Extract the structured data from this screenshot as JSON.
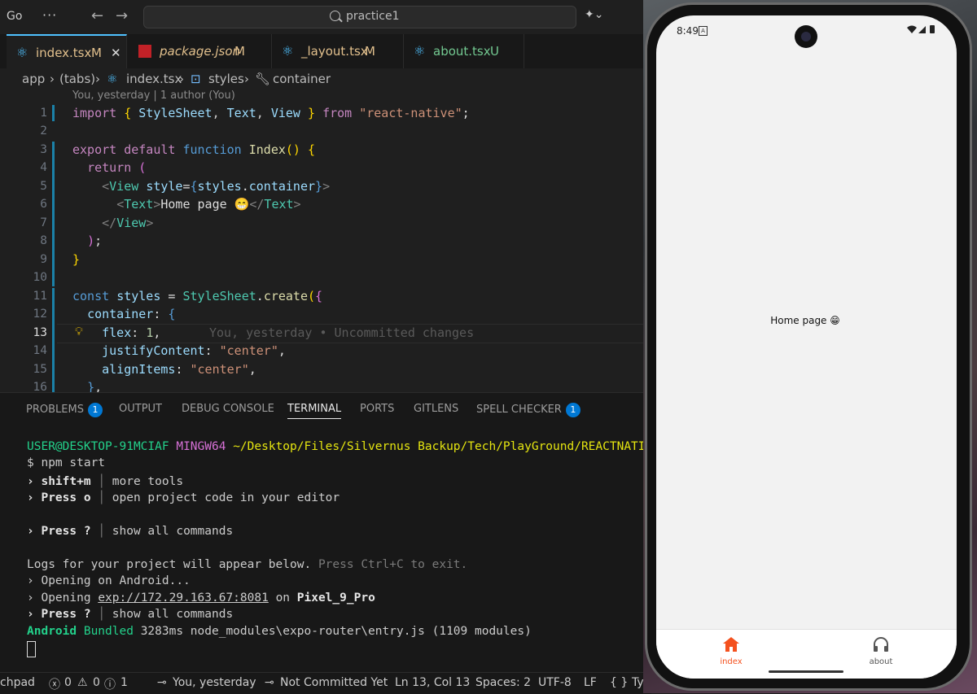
{
  "titlebar": {
    "go_label": "Go",
    "more_label": "···",
    "back": "←",
    "forward": "→",
    "search_text": "practice1"
  },
  "tabs": [
    {
      "label": "index.tsx",
      "status": "M"
    },
    {
      "label": "package.json",
      "status": "M"
    },
    {
      "label": "_layout.tsx",
      "status": "M"
    },
    {
      "label": "about.tsx",
      "status": "U"
    }
  ],
  "breadcrumb": {
    "p1": "app",
    "p2": "(tabs)",
    "p3": "index.tsx",
    "p4": "styles",
    "p5": "container"
  },
  "editor": {
    "blame_header": "You, yesterday | 1 author (You)",
    "inline_blame": "You, yesterday • Uncommitted changes",
    "line_numbers": [
      "1",
      "2",
      "3",
      "4",
      "5",
      "6",
      "7",
      "8",
      "9",
      "10",
      "11",
      "12",
      "13",
      "14",
      "15",
      "16"
    ]
  },
  "panel": {
    "tabs": {
      "problems": "PROBLEMS",
      "problems_count": "1",
      "output": "OUTPUT",
      "debug": "DEBUG CONSOLE",
      "terminal": "TERMINAL",
      "ports": "PORTS",
      "gitlens": "GITLENS",
      "spell": "SPELL CHECKER",
      "spell_count": "1"
    },
    "prompt_user": "USER@DESKTOP-91MCIAF",
    "prompt_env": "MINGW64",
    "prompt_path": "~/Desktop/Files/Silvernus Backup/Tech/PlayGround/REACTNATIV",
    "command": "$ npm start",
    "l1_key": "› shift+m",
    "l1_desc": "more tools",
    "l2_key": "› Press o",
    "l2_desc": "open project code in your editor",
    "l3_key": "› Press ?",
    "l3_desc": "show all commands",
    "logs_a": "Logs for your project will appear below.",
    "logs_b": "Press Ctrl+C to exit.",
    "opening_android": "› Opening on Android...",
    "opening_pre": "› Opening",
    "opening_url": "exp://172.29.163.67:8081",
    "opening_on": "on",
    "device": "Pixel_9_Pro",
    "l4_key": "› Press ?",
    "l4_desc": "show all commands",
    "bundle_platform": "Android",
    "bundle_word": "Bundled",
    "bundle_rest": "3283ms node_modules\\expo-router\\entry.js (1109 modules)"
  },
  "status": {
    "left": "chpad",
    "errors": "0",
    "warnings": "0",
    "infos": "1",
    "blame": "You, yesterday",
    "commit": "Not Committed Yet",
    "position": "Ln 13, Col 13",
    "spaces": "Spaces: 2",
    "encoding": "UTF-8",
    "eol": "LF",
    "language": "TypeScri"
  },
  "phone": {
    "time": "8:49",
    "content_text": "Home page 😁",
    "nav": [
      {
        "label": "index",
        "icon": "home-icon"
      },
      {
        "label": "about",
        "icon": "headphones-icon"
      }
    ],
    "accent": "#f4511e"
  }
}
